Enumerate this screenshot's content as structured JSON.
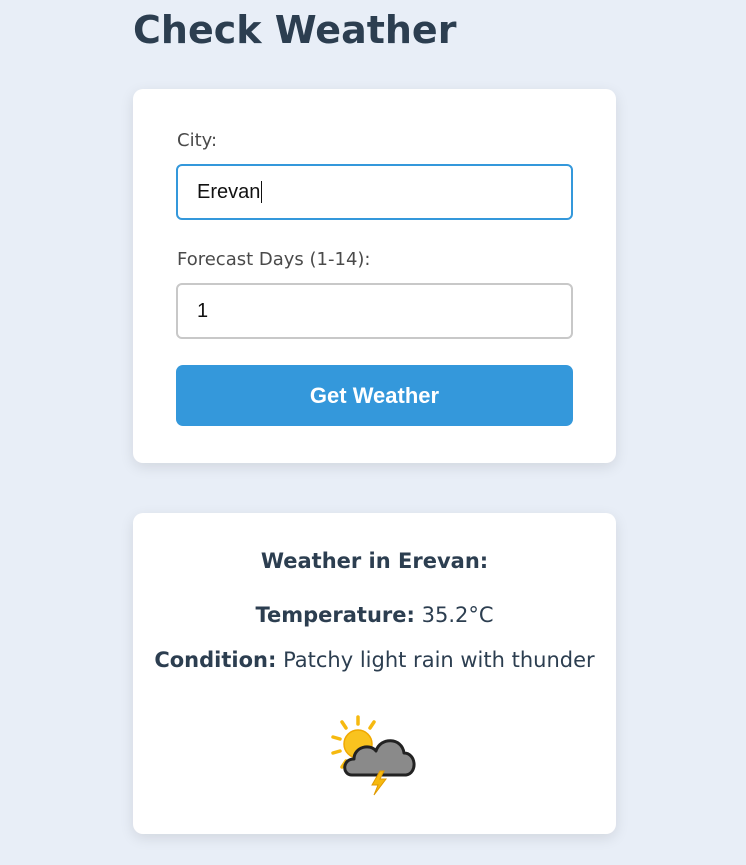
{
  "page": {
    "title": "Check Weather"
  },
  "form": {
    "city_label": "City:",
    "city_value": "Erevan",
    "days_label": "Forecast Days (1-14):",
    "days_value": "1",
    "submit_label": "Get Weather"
  },
  "result": {
    "heading": "Weather in Erevan:",
    "temperature_label": "Temperature:",
    "temperature_value": "35.2°C",
    "condition_label": "Condition:",
    "condition_value": "Patchy light rain with thunder",
    "icon": "sun-cloud-thunder-icon"
  },
  "colors": {
    "accent": "#3498db",
    "background": "#e8eef7",
    "text": "#2c3e50"
  }
}
